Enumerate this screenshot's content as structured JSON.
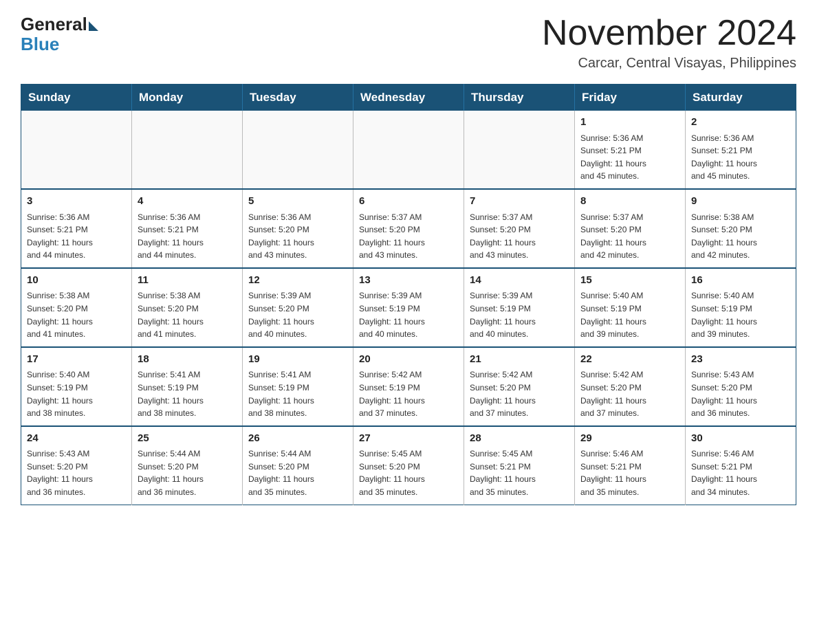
{
  "logo": {
    "general": "General",
    "blue": "Blue"
  },
  "header": {
    "month_year": "November 2024",
    "location": "Carcar, Central Visayas, Philippines"
  },
  "weekdays": [
    "Sunday",
    "Monday",
    "Tuesday",
    "Wednesday",
    "Thursday",
    "Friday",
    "Saturday"
  ],
  "weeks": [
    [
      {
        "day": "",
        "info": ""
      },
      {
        "day": "",
        "info": ""
      },
      {
        "day": "",
        "info": ""
      },
      {
        "day": "",
        "info": ""
      },
      {
        "day": "",
        "info": ""
      },
      {
        "day": "1",
        "info": "Sunrise: 5:36 AM\nSunset: 5:21 PM\nDaylight: 11 hours\nand 45 minutes."
      },
      {
        "day": "2",
        "info": "Sunrise: 5:36 AM\nSunset: 5:21 PM\nDaylight: 11 hours\nand 45 minutes."
      }
    ],
    [
      {
        "day": "3",
        "info": "Sunrise: 5:36 AM\nSunset: 5:21 PM\nDaylight: 11 hours\nand 44 minutes."
      },
      {
        "day": "4",
        "info": "Sunrise: 5:36 AM\nSunset: 5:21 PM\nDaylight: 11 hours\nand 44 minutes."
      },
      {
        "day": "5",
        "info": "Sunrise: 5:36 AM\nSunset: 5:20 PM\nDaylight: 11 hours\nand 43 minutes."
      },
      {
        "day": "6",
        "info": "Sunrise: 5:37 AM\nSunset: 5:20 PM\nDaylight: 11 hours\nand 43 minutes."
      },
      {
        "day": "7",
        "info": "Sunrise: 5:37 AM\nSunset: 5:20 PM\nDaylight: 11 hours\nand 43 minutes."
      },
      {
        "day": "8",
        "info": "Sunrise: 5:37 AM\nSunset: 5:20 PM\nDaylight: 11 hours\nand 42 minutes."
      },
      {
        "day": "9",
        "info": "Sunrise: 5:38 AM\nSunset: 5:20 PM\nDaylight: 11 hours\nand 42 minutes."
      }
    ],
    [
      {
        "day": "10",
        "info": "Sunrise: 5:38 AM\nSunset: 5:20 PM\nDaylight: 11 hours\nand 41 minutes."
      },
      {
        "day": "11",
        "info": "Sunrise: 5:38 AM\nSunset: 5:20 PM\nDaylight: 11 hours\nand 41 minutes."
      },
      {
        "day": "12",
        "info": "Sunrise: 5:39 AM\nSunset: 5:20 PM\nDaylight: 11 hours\nand 40 minutes."
      },
      {
        "day": "13",
        "info": "Sunrise: 5:39 AM\nSunset: 5:19 PM\nDaylight: 11 hours\nand 40 minutes."
      },
      {
        "day": "14",
        "info": "Sunrise: 5:39 AM\nSunset: 5:19 PM\nDaylight: 11 hours\nand 40 minutes."
      },
      {
        "day": "15",
        "info": "Sunrise: 5:40 AM\nSunset: 5:19 PM\nDaylight: 11 hours\nand 39 minutes."
      },
      {
        "day": "16",
        "info": "Sunrise: 5:40 AM\nSunset: 5:19 PM\nDaylight: 11 hours\nand 39 minutes."
      }
    ],
    [
      {
        "day": "17",
        "info": "Sunrise: 5:40 AM\nSunset: 5:19 PM\nDaylight: 11 hours\nand 38 minutes."
      },
      {
        "day": "18",
        "info": "Sunrise: 5:41 AM\nSunset: 5:19 PM\nDaylight: 11 hours\nand 38 minutes."
      },
      {
        "day": "19",
        "info": "Sunrise: 5:41 AM\nSunset: 5:19 PM\nDaylight: 11 hours\nand 38 minutes."
      },
      {
        "day": "20",
        "info": "Sunrise: 5:42 AM\nSunset: 5:19 PM\nDaylight: 11 hours\nand 37 minutes."
      },
      {
        "day": "21",
        "info": "Sunrise: 5:42 AM\nSunset: 5:20 PM\nDaylight: 11 hours\nand 37 minutes."
      },
      {
        "day": "22",
        "info": "Sunrise: 5:42 AM\nSunset: 5:20 PM\nDaylight: 11 hours\nand 37 minutes."
      },
      {
        "day": "23",
        "info": "Sunrise: 5:43 AM\nSunset: 5:20 PM\nDaylight: 11 hours\nand 36 minutes."
      }
    ],
    [
      {
        "day": "24",
        "info": "Sunrise: 5:43 AM\nSunset: 5:20 PM\nDaylight: 11 hours\nand 36 minutes."
      },
      {
        "day": "25",
        "info": "Sunrise: 5:44 AM\nSunset: 5:20 PM\nDaylight: 11 hours\nand 36 minutes."
      },
      {
        "day": "26",
        "info": "Sunrise: 5:44 AM\nSunset: 5:20 PM\nDaylight: 11 hours\nand 35 minutes."
      },
      {
        "day": "27",
        "info": "Sunrise: 5:45 AM\nSunset: 5:20 PM\nDaylight: 11 hours\nand 35 minutes."
      },
      {
        "day": "28",
        "info": "Sunrise: 5:45 AM\nSunset: 5:21 PM\nDaylight: 11 hours\nand 35 minutes."
      },
      {
        "day": "29",
        "info": "Sunrise: 5:46 AM\nSunset: 5:21 PM\nDaylight: 11 hours\nand 35 minutes."
      },
      {
        "day": "30",
        "info": "Sunrise: 5:46 AM\nSunset: 5:21 PM\nDaylight: 11 hours\nand 34 minutes."
      }
    ]
  ]
}
